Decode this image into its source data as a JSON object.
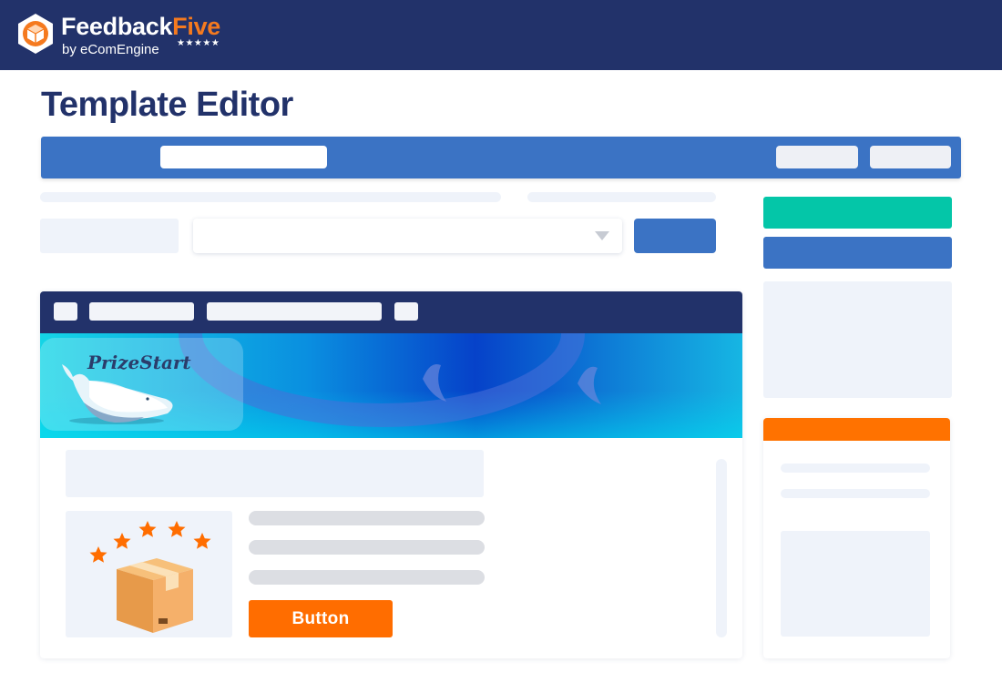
{
  "brand": {
    "name_part1": "Feedback",
    "name_part2": "Five",
    "byline": "by eComEngine",
    "rating_stars": "★★★★★",
    "colors": {
      "navy": "#22326a",
      "orange": "#f57a1f"
    }
  },
  "page": {
    "title": "Template Editor"
  },
  "preview": {
    "banner_logo": "PrizeStart",
    "cta_label": "Button"
  },
  "colors": {
    "toolbar_blue": "#3b73c4",
    "teal_button": "#04c6a8",
    "orange_accent": "#ff6d00",
    "skeleton": "#eff3fa"
  },
  "icons": [
    "feedbackfive-logo-icon",
    "dropdown-caret-icon",
    "whale-icon",
    "star-icon",
    "package-box-icon"
  ]
}
